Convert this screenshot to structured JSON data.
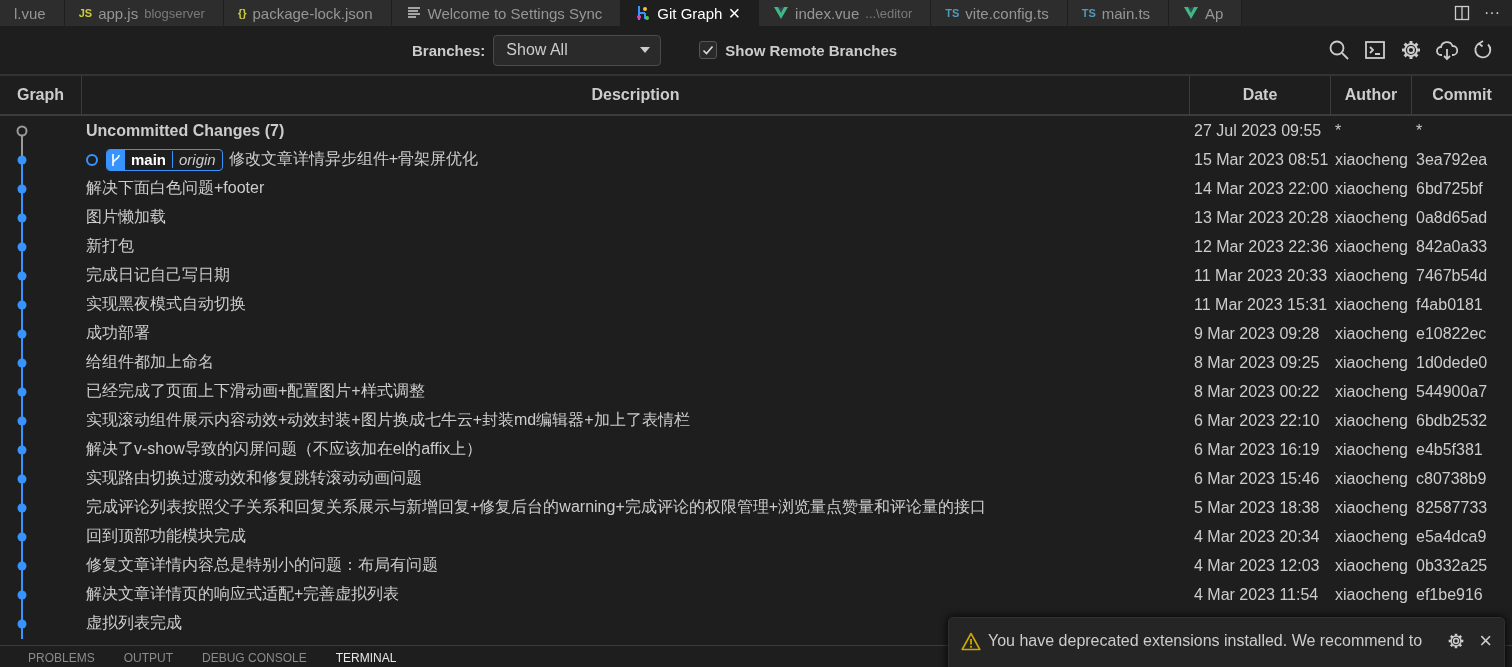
{
  "editor_tabs": [
    {
      "label": "l.vue",
      "kind": "plain",
      "selected": false
    },
    {
      "label": "app.js",
      "badge": "JS",
      "detail": "blogserver",
      "kind": "js",
      "selected": false
    },
    {
      "label": "package-lock.json",
      "badge": "{}",
      "kind": "json",
      "selected": false
    },
    {
      "label": "Welcome to Settings Sync",
      "kind": "doc",
      "selected": false
    },
    {
      "label": "Git Graph",
      "kind": "graph",
      "selected": true,
      "close": "×"
    },
    {
      "label": "index.vue",
      "detail": "...\\editor",
      "kind": "vue",
      "selected": false
    },
    {
      "label": "vite.config.ts",
      "badge": "TS",
      "kind": "ts",
      "selected": false
    },
    {
      "label": "main.ts",
      "badge": "TS",
      "kind": "ts",
      "selected": false
    },
    {
      "label": "Ap",
      "kind": "vue",
      "selected": false
    }
  ],
  "tab_actions": {
    "more": "···"
  },
  "toolbar": {
    "branches_label": "Branches:",
    "branches_value": "Show All",
    "show_remote": {
      "label": "Show Remote Branches",
      "checked": true
    }
  },
  "table": {
    "columns": [
      "Graph",
      "Description",
      "Date",
      "Author",
      "Commit"
    ],
    "rows": [
      {
        "kind": "uncommitted",
        "description": "Uncommitted Changes (7)",
        "date": "27 Jul 2023 09:55",
        "author": "*",
        "commit": "*"
      },
      {
        "kind": "commit",
        "head": true,
        "refs": [
          {
            "name": "main",
            "remote": "origin"
          }
        ],
        "description": "修改文章详情异步组件+骨架屏优化",
        "date": "15 Mar 2023 08:51",
        "author": "xiaocheng",
        "commit": "3ea792ea"
      },
      {
        "kind": "commit",
        "head": false,
        "description": "解决下面白色问题+footer",
        "date": "14 Mar 2023 22:00",
        "author": "xiaocheng",
        "commit": "6bd725bf"
      },
      {
        "kind": "commit",
        "head": false,
        "description": "图片懒加载",
        "date": "13 Mar 2023 20:28",
        "author": "xiaocheng",
        "commit": "0a8d65ad"
      },
      {
        "kind": "commit",
        "head": false,
        "description": "新打包",
        "date": "12 Mar 2023 22:36",
        "author": "xiaocheng",
        "commit": "842a0a33"
      },
      {
        "kind": "commit",
        "head": false,
        "description": "完成日记自己写日期",
        "date": "11 Mar 2023 20:33",
        "author": "xiaocheng",
        "commit": "7467b54d"
      },
      {
        "kind": "commit",
        "head": false,
        "description": "实现黑夜模式自动切换",
        "date": "11 Mar 2023 15:31",
        "author": "xiaocheng",
        "commit": "f4ab0181"
      },
      {
        "kind": "commit",
        "head": false,
        "description": "成功部署",
        "date": "9 Mar 2023 09:28",
        "author": "xiaocheng",
        "commit": "e10822ec"
      },
      {
        "kind": "commit",
        "head": false,
        "description": "给组件都加上命名",
        "date": "8 Mar 2023 09:25",
        "author": "xiaocheng",
        "commit": "1d0dede0"
      },
      {
        "kind": "commit",
        "head": false,
        "description": "已经完成了页面上下滑动画+配置图片+样式调整",
        "date": "8 Mar 2023 00:22",
        "author": "xiaocheng",
        "commit": "544900a7"
      },
      {
        "kind": "commit",
        "head": false,
        "description": "实现滚动组件展示内容动效+动效封装+图片换成七牛云+封装md编辑器+加上了表情栏",
        "date": "6 Mar 2023 22:10",
        "author": "xiaocheng",
        "commit": "6bdb2532"
      },
      {
        "kind": "commit",
        "head": false,
        "description": "解决了v-show导致的闪屏问题（不应该加在el的affix上）",
        "date": "6 Mar 2023 16:19",
        "author": "xiaocheng",
        "commit": "e4b5f381"
      },
      {
        "kind": "commit",
        "head": false,
        "description": "实现路由切换过渡动效和修复跳转滚动动画问题",
        "date": "6 Mar 2023 15:46",
        "author": "xiaocheng",
        "commit": "c80738b9"
      },
      {
        "kind": "commit",
        "head": false,
        "description": "完成评论列表按照父子关系和回复关系展示与新增回复+修复后台的warning+完成评论的权限管理+浏览量点赞量和评论量的接口",
        "date": "5 Mar 2023 18:38",
        "author": "xiaocheng",
        "commit": "82587733"
      },
      {
        "kind": "commit",
        "head": false,
        "description": "回到顶部功能模块完成",
        "date": "4 Mar 2023 20:34",
        "author": "xiaocheng",
        "commit": "e5a4dca9"
      },
      {
        "kind": "commit",
        "head": false,
        "description": "修复文章详情内容总是特别小的问题：布局有问题",
        "date": "4 Mar 2023 12:03",
        "author": "xiaocheng",
        "commit": "0b332a25"
      },
      {
        "kind": "commit",
        "head": false,
        "description": "解决文章详情页的响应式适配+完善虚拟列表",
        "date": "4 Mar 2023 11:54",
        "author": "xiaocheng",
        "commit": "ef1be916"
      },
      {
        "kind": "commit",
        "head": false,
        "description": "虚拟列表完成"
      }
    ]
  },
  "panel_tabs": [
    {
      "label": "PROBLEMS",
      "selected": false
    },
    {
      "label": "OUTPUT",
      "selected": false
    },
    {
      "label": "DEBUG CONSOLE",
      "selected": false
    },
    {
      "label": "TERMINAL",
      "selected": true
    }
  ],
  "notification": {
    "message": "You have deprecated extensions installed. We recommend to",
    "close": "×"
  }
}
